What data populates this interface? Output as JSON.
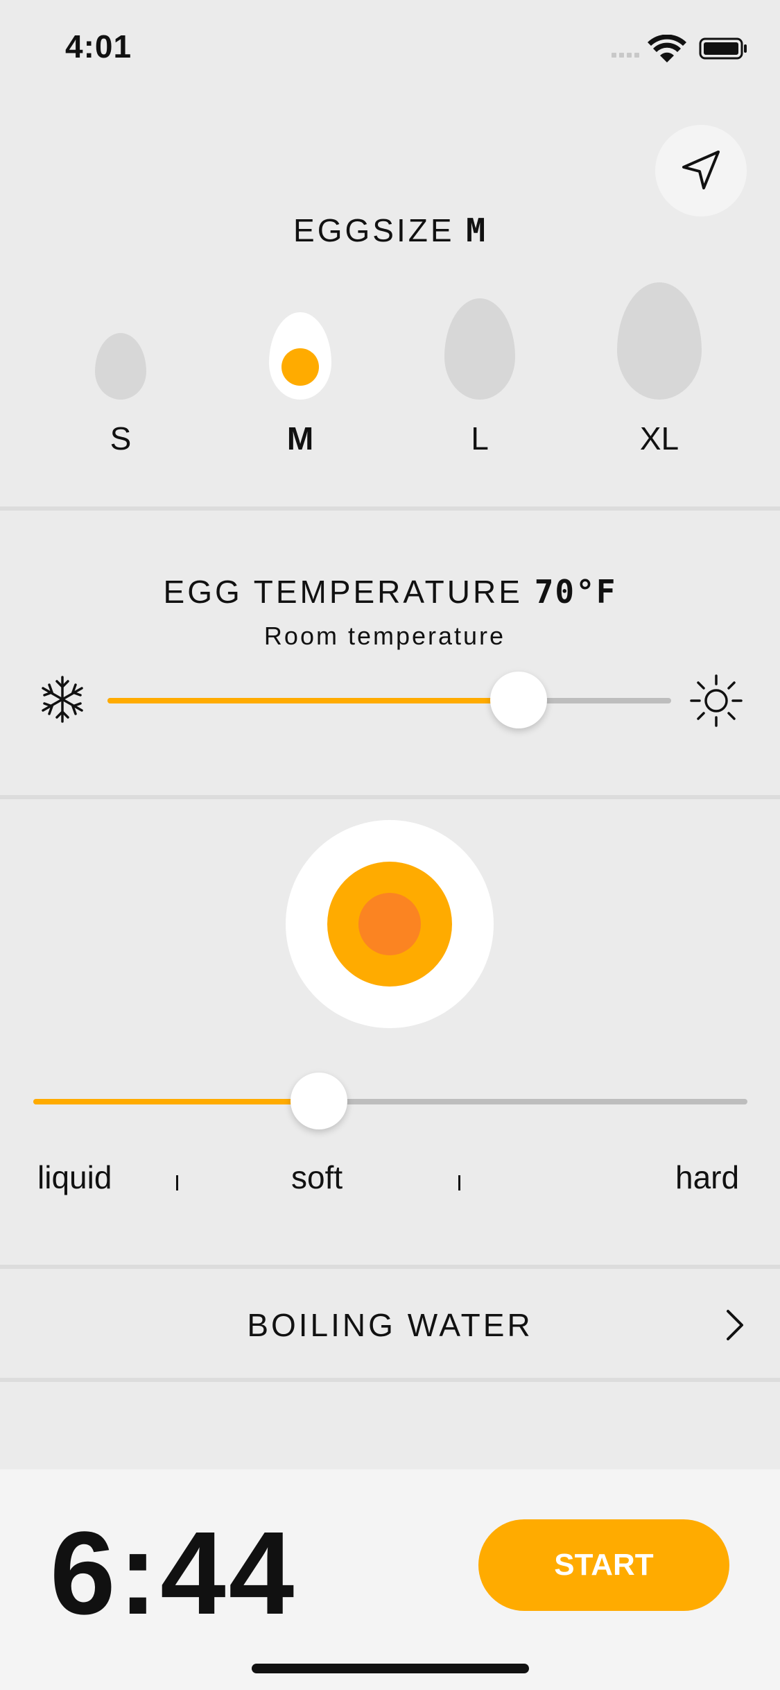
{
  "status_bar": {
    "time": "4:01"
  },
  "location_button": {
    "icon": "location-arrow-icon"
  },
  "egg_size": {
    "title": "EGGSIZE",
    "value": "M",
    "options": [
      "S",
      "M",
      "L",
      "XL"
    ],
    "selected": "M"
  },
  "egg_temperature": {
    "title": "EGG TEMPERATURE",
    "value": "70°F",
    "subtitle": "Room temperature",
    "slider_fraction": 0.73,
    "cold_icon": "snowflake-icon",
    "hot_icon": "sun-icon"
  },
  "doneness": {
    "slider_fraction": 0.4,
    "labels": [
      "liquid",
      "soft",
      "hard"
    ]
  },
  "boiling_water": {
    "label": "BOILING WATER"
  },
  "timer": {
    "value": "6:44",
    "start_label": "START"
  },
  "colors": {
    "accent": "#ffab00",
    "yolk_core": "#fb8422",
    "background": "#ebebeb",
    "bottom_bar": "#f4f4f4"
  }
}
